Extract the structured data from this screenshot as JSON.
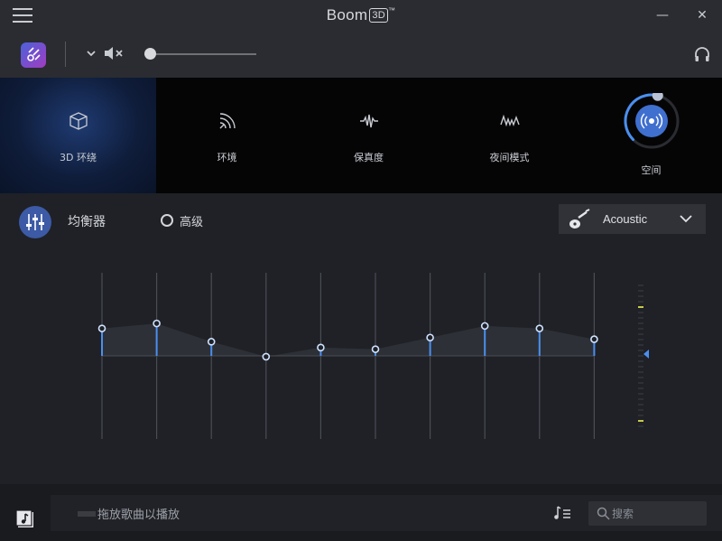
{
  "titlebar": {
    "brand": "Boom",
    "badge": "3D",
    "tm": "™",
    "minimize_glyph": "—",
    "close_glyph": "✕"
  },
  "toolbar": {
    "volume_level": 0.05,
    "icons": [
      "app-icon",
      "chevron-down-icon",
      "mute-icon",
      "headphones-icon"
    ]
  },
  "modes": [
    {
      "label": "3D 环绕",
      "icon": "cube-icon",
      "active": true
    },
    {
      "label": "环境",
      "icon": "ambience-icon",
      "active": false
    },
    {
      "label": "保真度",
      "icon": "fidelity-icon",
      "active": false
    },
    {
      "label": "夜间模式",
      "icon": "night-mode-icon",
      "active": false
    },
    {
      "label": "空间",
      "icon": "spatial-icon",
      "active": false
    }
  ],
  "spatial_level": 0.55,
  "eq": {
    "title": "均衡器",
    "advanced_label": "高级",
    "advanced_checked": false,
    "preset": "Acoustic",
    "bands_level": [
      0.33,
      0.39,
      0.17,
      -0.01,
      0.1,
      0.08,
      0.22,
      0.36,
      0.33,
      0.2
    ],
    "gain_level": 0.0,
    "colors": {
      "accent": "#4a8ff0",
      "knob": "#cfe2ff",
      "gain_mark": "#c9c94a"
    }
  },
  "footer": {
    "drop_text": "拖放歌曲以播放",
    "search_placeholder": "搜索"
  }
}
